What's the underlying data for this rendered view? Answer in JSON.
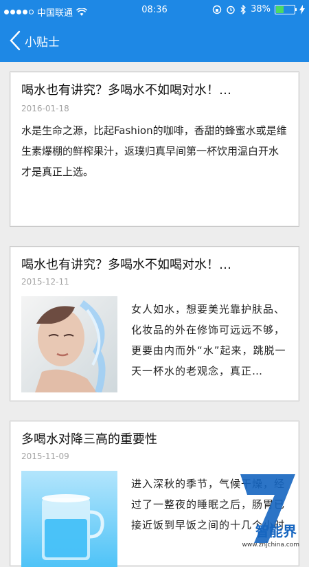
{
  "status_bar": {
    "carrier": "中国联通",
    "time": "08:36",
    "battery_percent": "38%",
    "battery_level": 0.38
  },
  "nav": {
    "title": "小贴士"
  },
  "articles": [
    {
      "title": "喝水也有讲究？多喝水不如喝对水！…",
      "date": "2016-01-18",
      "summary": "水是生命之源，比起Fashion的咖啡，香甜的蜂蜜水或是维生素爆棚的鲜榨果汁，返璞归真早间第一杯饮用温白开水才是真正上选。"
    },
    {
      "title": "喝水也有讲究？多喝水不如喝对水！…",
      "date": "2015-12-11",
      "summary": "女人如水，想要美光靠护肤品、化妆品的外在修饰可远远不够，更要由内而外“水”起来，跳脱一天一杯水的老观念，真正…"
    },
    {
      "title": "多喝水对降三高的重要性",
      "date": "2015-11-09",
      "summary": "进入深秋的季节，气候干燥，经过了一整夜的睡眠之后，肠胃已接近饭到早饭之间的十几个小时"
    }
  ],
  "watermark": {
    "brand": "智能界",
    "url": "www.znjchina.com"
  }
}
